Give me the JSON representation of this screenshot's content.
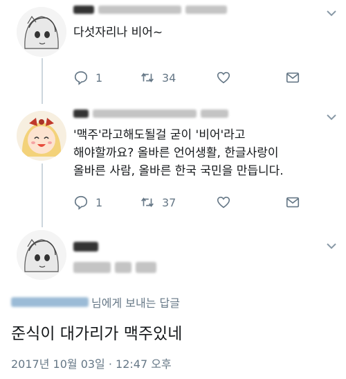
{
  "tweets": [
    {
      "body": "다섯자리나 비어~",
      "actions": {
        "reply_count": "1",
        "retweet_count": "34"
      }
    },
    {
      "body": "'맥주'라고해도될걸 굳이 '비어'라고\n해야할까요? 올바른 언어생활, 한글사랑이\n올바른 사람, 올바른 한국 국민을 만듭니다.",
      "actions": {
        "reply_count": "1",
        "retweet_count": "37"
      }
    }
  ],
  "focused_tweet": {
    "reply_to_suffix": "님에게 보내는 답글",
    "text": "준식이 대가리가 맥주있네",
    "timestamp": "2017년 10월 03일 · 12:47 오후"
  },
  "icons": {
    "reply": "reply-icon",
    "retweet": "retweet-icon",
    "like": "heart-icon",
    "dm": "envelope-icon",
    "caret": "chevron-down-icon"
  },
  "colors": {
    "text": "#14171a",
    "muted": "#657786",
    "line": "#ccd6dd"
  }
}
